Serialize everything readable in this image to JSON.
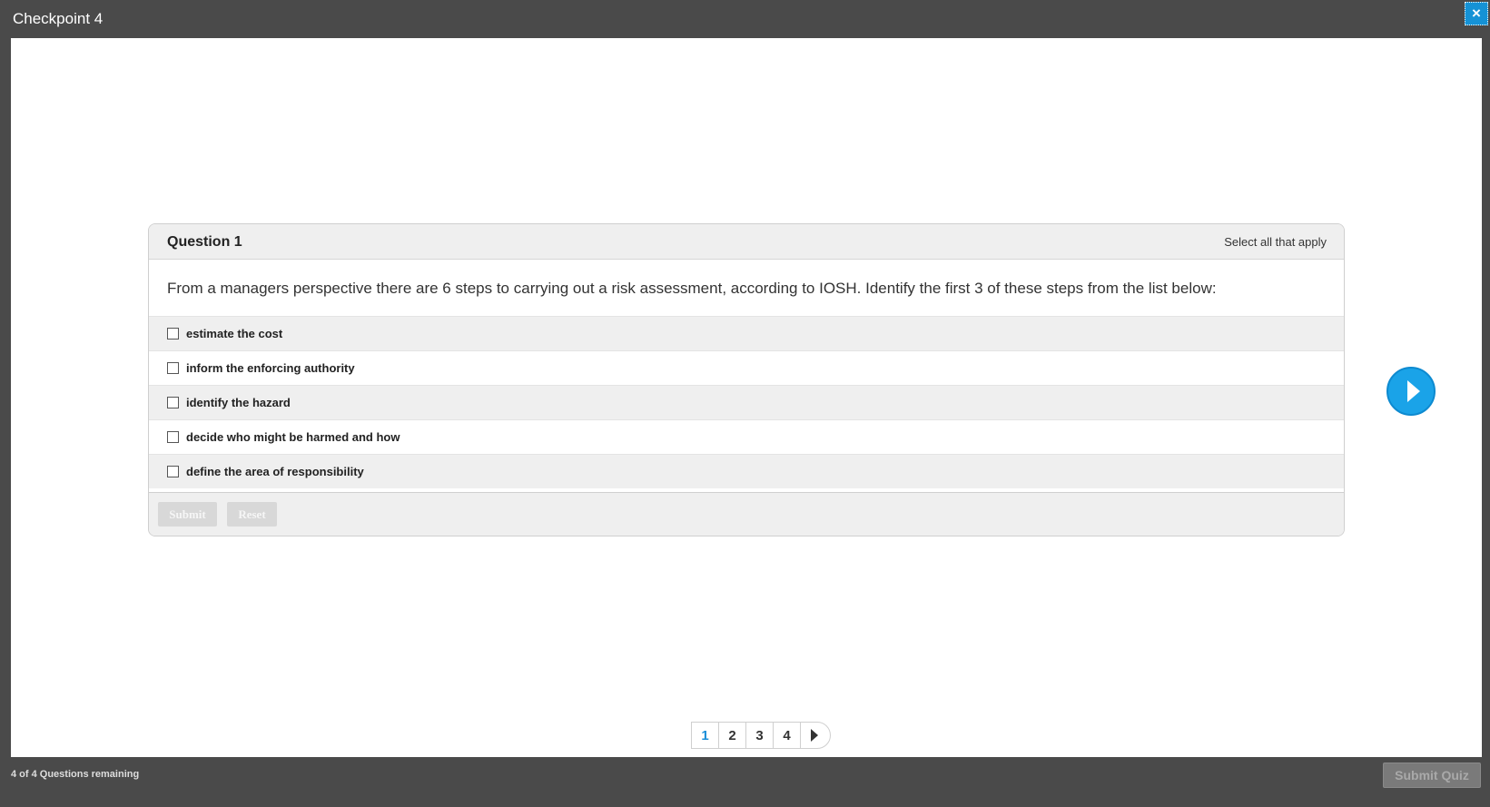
{
  "window": {
    "title": "Checkpoint 4",
    "close_label": "×"
  },
  "question": {
    "number_label": "Question 1",
    "instruction": "Select all that apply",
    "text": "From a managers perspective there are 6 steps to carrying out a risk assessment, according to IOSH. Identify the first 3 of these steps from the list below:",
    "answers": [
      {
        "label": "estimate the cost",
        "checked": false
      },
      {
        "label": "inform the enforcing authority",
        "checked": false
      },
      {
        "label": "identify the hazard",
        "checked": false
      },
      {
        "label": "decide who might be harmed and how",
        "checked": false
      },
      {
        "label": "define the area of responsibility",
        "checked": false
      }
    ],
    "submit_label": "Submit",
    "reset_label": "Reset"
  },
  "pagination": {
    "pages": [
      "1",
      "2",
      "3",
      "4"
    ],
    "current": "1"
  },
  "footer": {
    "remaining": "4 of 4 Questions remaining",
    "submit_quiz_label": "Submit Quiz"
  },
  "colors": {
    "accent": "#1aa3e8",
    "header_bg": "#4a4a4a"
  }
}
